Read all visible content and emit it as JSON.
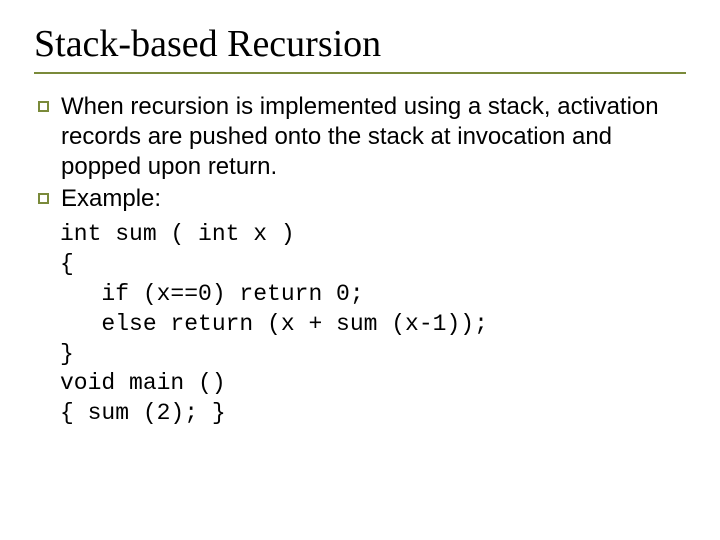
{
  "title": "Stack-based Recursion",
  "bullets": [
    "When recursion is implemented using a stack, activation records are pushed onto the stack at invocation and popped upon return.",
    "Example:"
  ],
  "code": "int sum ( int x )\n{\n   if (x==0) return 0;\n   else return (x + sum (x-1));\n}\nvoid main ()\n{ sum (2); }"
}
